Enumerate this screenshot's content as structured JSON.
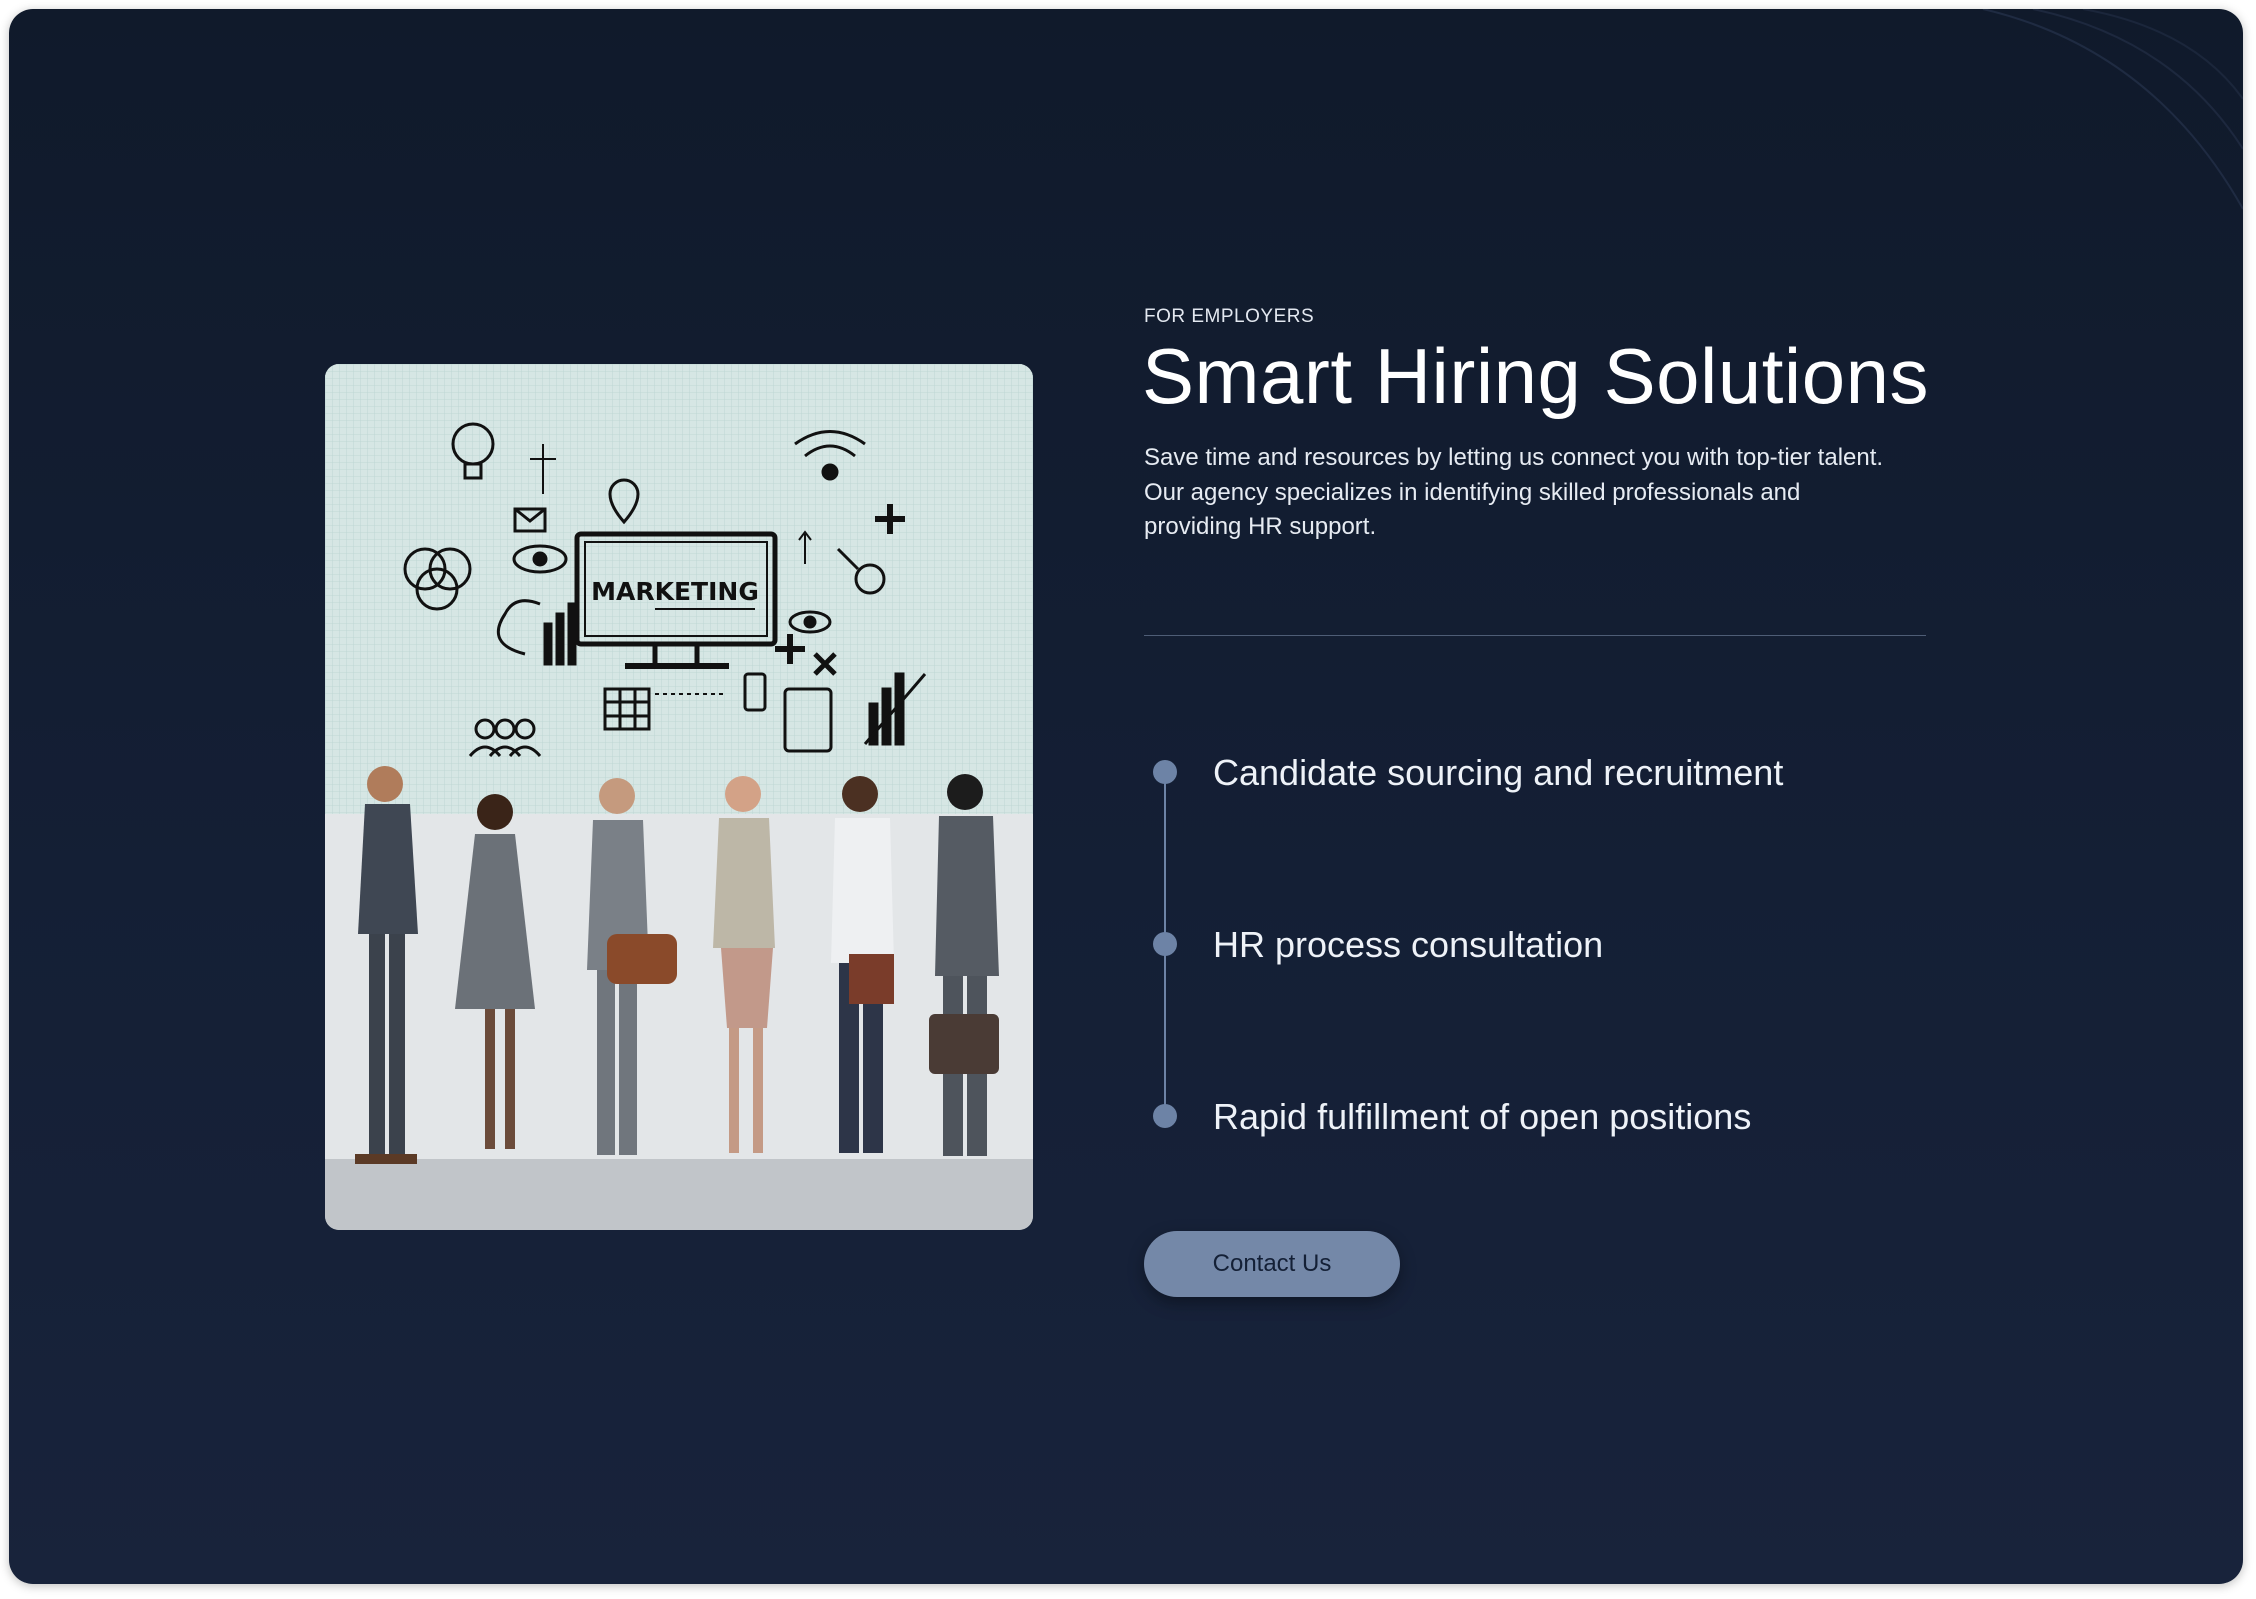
{
  "section": {
    "eyebrow": "FOR EMPLOYERS",
    "title": "Smart Hiring Solutions",
    "description": "Save time and resources by letting us connect you with top-tier talent. Our agency specializes in identifying skilled professionals and providing HR support."
  },
  "image": {
    "board_text": "MARKETING"
  },
  "features": [
    {
      "label": "Candidate sourcing and recruitment"
    },
    {
      "label": "HR process consultation"
    },
    {
      "label": "Rapid fulfillment of open positions"
    }
  ],
  "cta": {
    "label": "Contact Us"
  },
  "colors": {
    "background": "#121c2f",
    "accent": "#7488a8",
    "timeline": "#6d83a6",
    "text": "#ffffff"
  }
}
